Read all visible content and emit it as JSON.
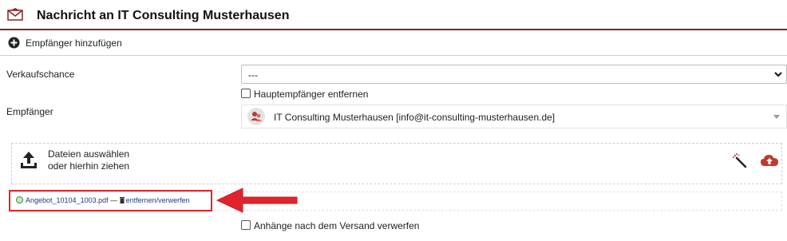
{
  "header": {
    "title": "Nachricht an IT Consulting Musterhausen"
  },
  "toolbar": {
    "add_recipient": "Empfänger hinzufügen"
  },
  "opportunity": {
    "label": "Verkaufschance",
    "value": "---"
  },
  "primary_remove": {
    "label": "Hauptempfänger entfernen",
    "checked": false
  },
  "recipient": {
    "label": "Empfänger",
    "value": "IT Consulting Musterhausen [info@it-consulting-musterhausen.de]"
  },
  "upload": {
    "line1": "Dateien auswählen",
    "line2": "oder hierhin ziehen"
  },
  "attachment": {
    "filename": "Angebot_10104_1003.pdf",
    "separator": "—",
    "remove_label": "entfernen/verwerfen"
  },
  "discard_after_send": {
    "label": "Anhänge nach dem Versand verwerfen",
    "checked": false
  },
  "colors": {
    "accent": "#8b2424",
    "highlight": "#e0242c",
    "link": "#1f3a8a"
  }
}
